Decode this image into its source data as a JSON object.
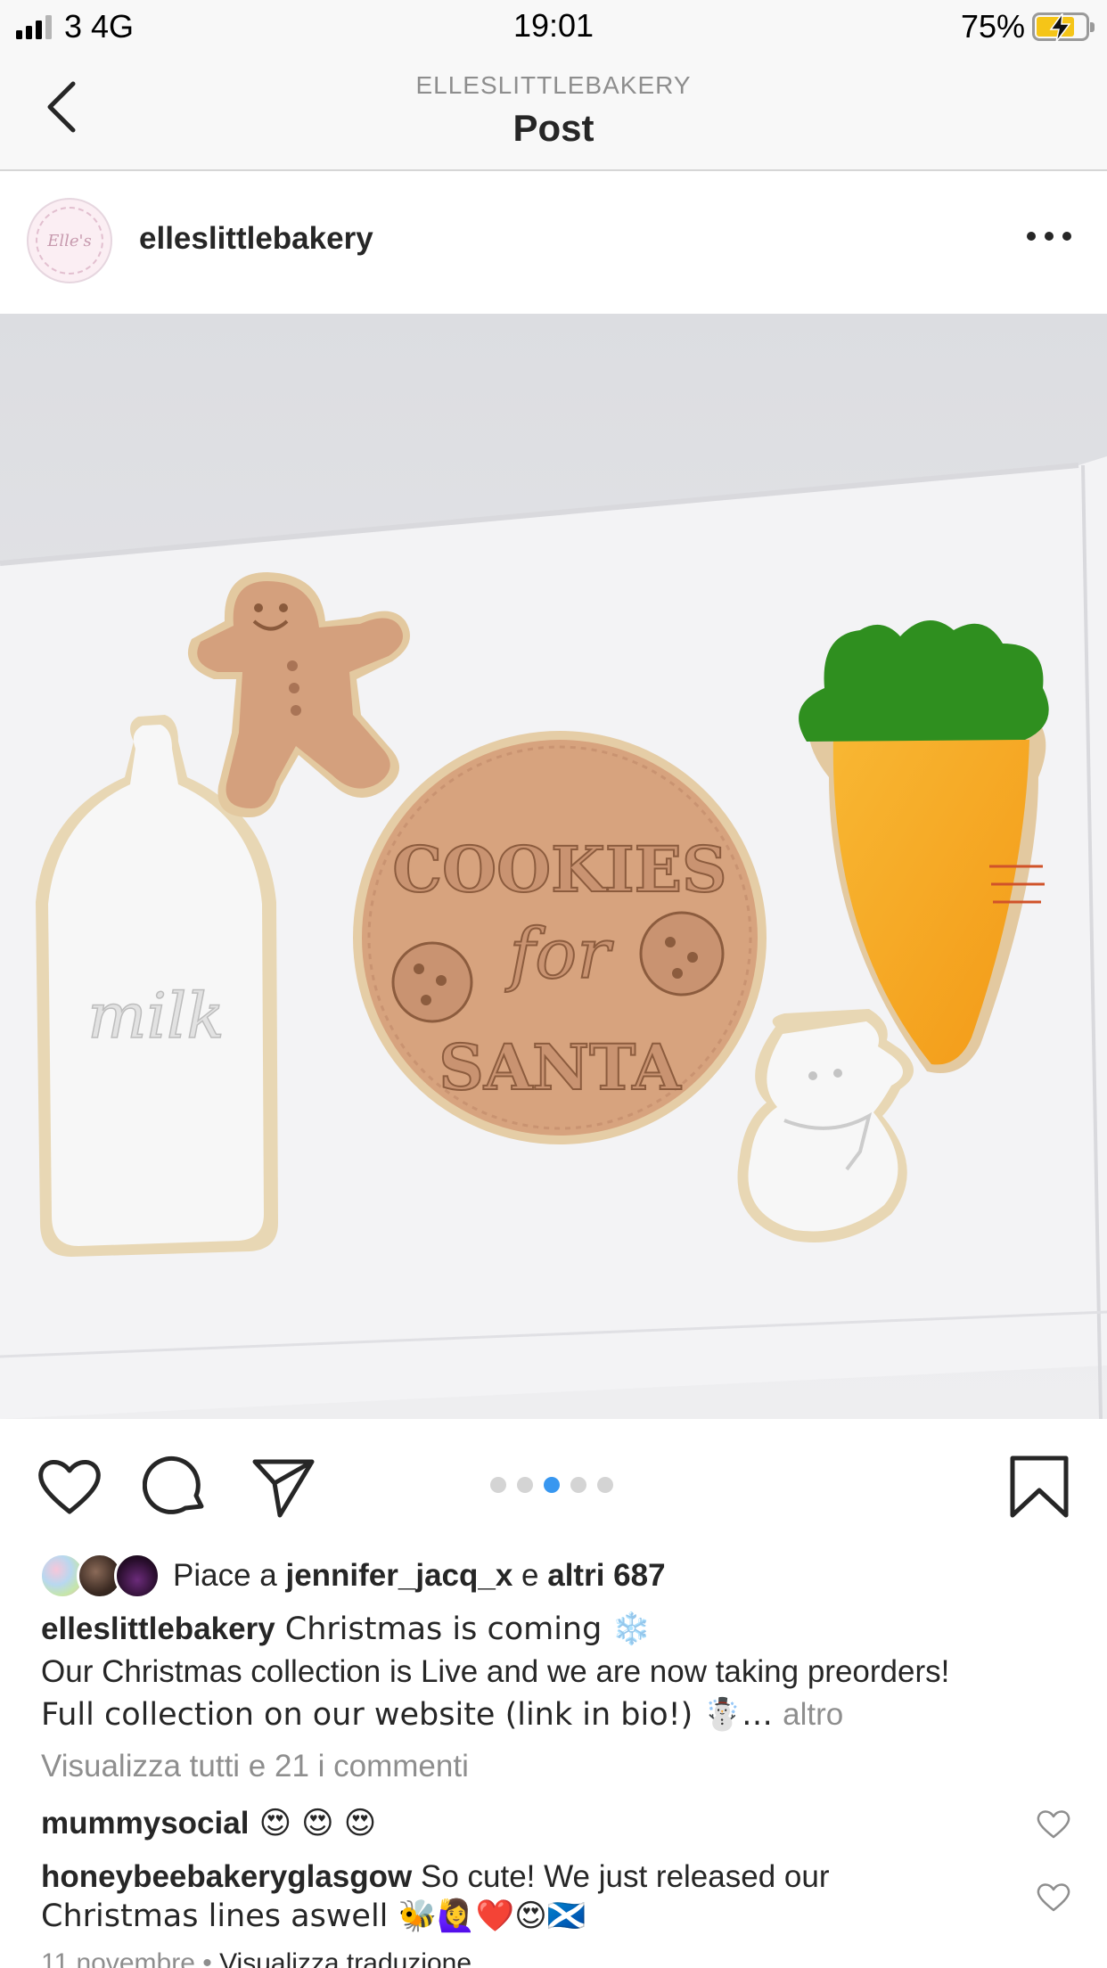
{
  "status_bar": {
    "carrier": "3 4G",
    "time": "19:01",
    "battery": "75%",
    "battery_level": 0.75,
    "icons": [
      "signal-icon",
      "battery-charging-icon"
    ]
  },
  "nav": {
    "account": "ELLESLITTLEBAKERY",
    "title": "Post",
    "back_icon": "chevron-left-icon"
  },
  "post": {
    "username": "elleslittlebakery",
    "avatar_text": "Elle's",
    "more_icon": "more-horizontal-icon",
    "image_texts": {
      "cookie_top": "COOKIES",
      "cookie_mid": "for",
      "cookie_bottom": "SANTA",
      "milk": "milk"
    },
    "carousel": {
      "count": 5,
      "active_index": 2
    },
    "likes": {
      "prefix": "Piace a ",
      "user": "jennifer_jacq_x",
      "middle": " e ",
      "others": "altri 687"
    },
    "caption": {
      "author": "elleslittlebakery",
      "line1": " Christmas is coming ❄️",
      "line2": "Our Christmas collection is Live and we are now taking preorders!",
      "line3": "Full collection on our website (link in bio!) ☃️… ",
      "more": "altro"
    },
    "view_comments": "Visualizza tutti e 21 i commenti",
    "comments": [
      {
        "user": "mummysocial",
        "text": " 😍 😍 😍"
      },
      {
        "user": "honeybeebakeryglasgow",
        "text_line1": " So cute! We just released our",
        "text_line2": "Christmas lines aswell 🐝🙋‍♀️❤️😍🏴󠁧󠁢󠁳󠁣󠁴󠁿"
      }
    ],
    "date": "11 novembre",
    "separator": " • ",
    "translate": "Visualizza traduzione"
  },
  "colors": {
    "accent_blue": "#3897f0",
    "text": "#262626",
    "secondary": "#8e8e8e",
    "carrot_orange": "#f5a623",
    "carrot_green": "#2f8f1f",
    "cookie_tan": "#d7a37e"
  }
}
